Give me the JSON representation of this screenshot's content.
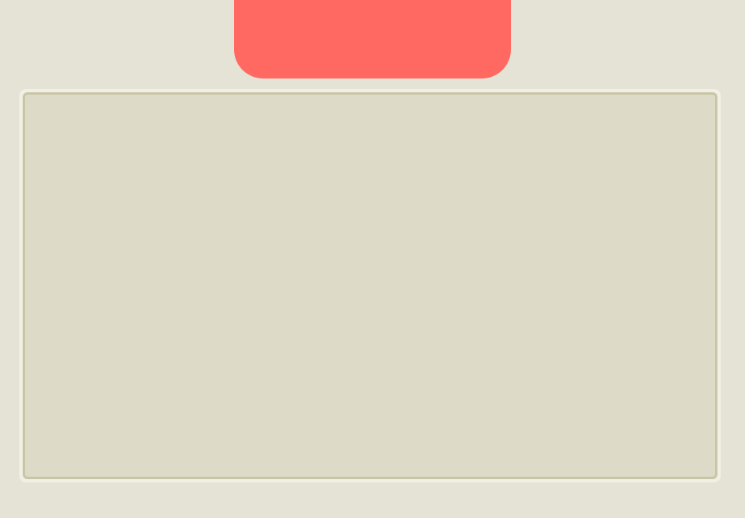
{
  "colors": {
    "background": "#e5e3d5",
    "tab_fill": "#ff6961",
    "panel_fill": "#dddac8",
    "panel_border": "#c9c6a8",
    "panel_highlight": "#f2f0e4"
  },
  "tab": {
    "label": ""
  },
  "panel": {
    "content": ""
  }
}
